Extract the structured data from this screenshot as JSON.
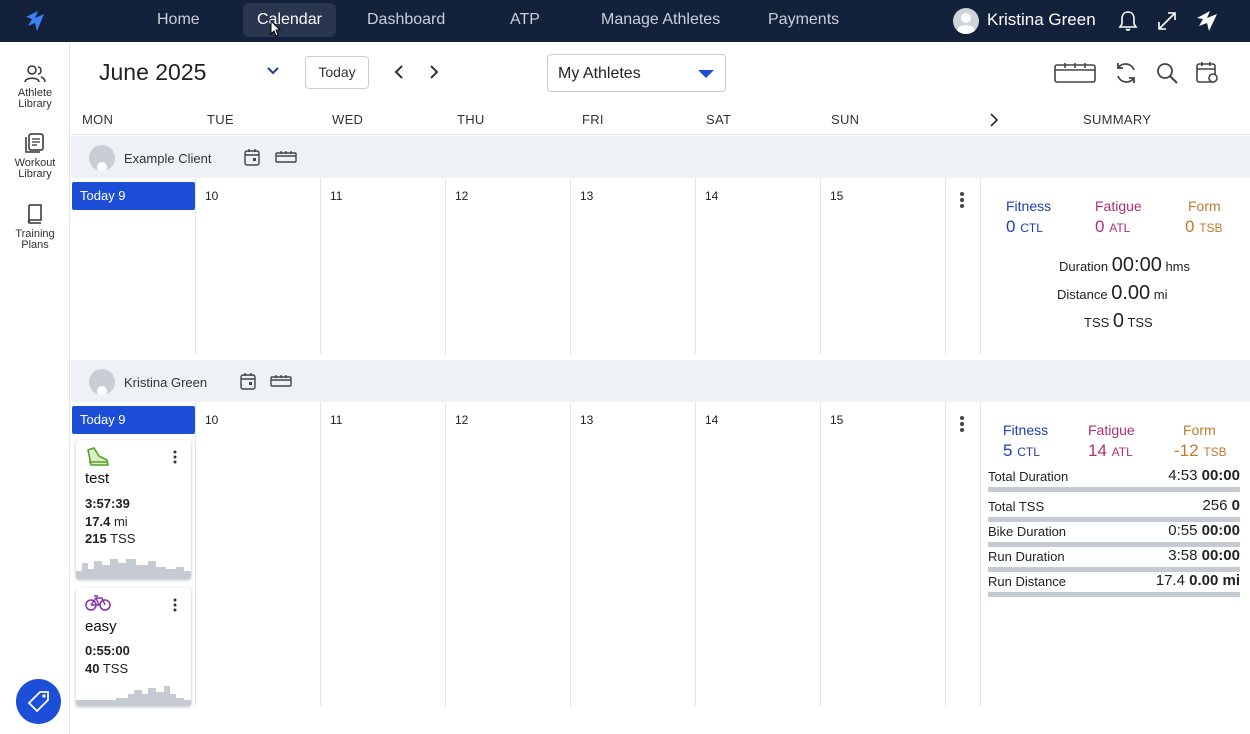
{
  "nav": {
    "items": [
      "Home",
      "Calendar",
      "Dashboard",
      "ATP",
      "Manage Athletes",
      "Payments"
    ],
    "active": "Calendar",
    "user_name": "Kristina Green"
  },
  "rail": {
    "athlete_library": [
      "Athlete",
      "Library"
    ],
    "workout_library": [
      "Workout",
      "Library"
    ],
    "training_plans": [
      "Training",
      "Plans"
    ]
  },
  "toolbar": {
    "month": "June 2025",
    "today": "Today",
    "athletes_select": "My Athletes"
  },
  "days": [
    "MON",
    "TUE",
    "WED",
    "THU",
    "FRI",
    "SAT",
    "SUN"
  ],
  "summary_header": "SUMMARY",
  "athletes": [
    {
      "name": "Example Client",
      "today_label": "Today 9",
      "dates": [
        "10",
        "11",
        "12",
        "13",
        "14",
        "15"
      ],
      "fitness": {
        "label": "Fitness",
        "value": "0",
        "unit": "CTL"
      },
      "fatigue": {
        "label": "Fatigue",
        "value": "0",
        "unit": "ATL"
      },
      "form": {
        "label": "Form",
        "value": "0",
        "unit": "TSB"
      },
      "duration": {
        "label": "Duration",
        "value": "00:00",
        "unit": "hms"
      },
      "distance": {
        "label": "Distance",
        "value": "0.00",
        "unit": "mi"
      },
      "tss": {
        "label": "TSS",
        "value": "0",
        "unit": "TSS"
      }
    },
    {
      "name": "Kristina Green",
      "today_label": "Today 9",
      "dates": [
        "10",
        "11",
        "12",
        "13",
        "14",
        "15"
      ],
      "fitness": {
        "label": "Fitness",
        "value": "5",
        "unit": "CTL"
      },
      "fatigue": {
        "label": "Fatigue",
        "value": "14",
        "unit": "ATL"
      },
      "form": {
        "label": "Form",
        "value": "-12",
        "unit": "TSB"
      },
      "rows": [
        {
          "label": "Total Duration",
          "value": "4:53",
          "planned": "00:00"
        },
        {
          "label": "Total TSS",
          "value": "256",
          "planned": "0"
        },
        {
          "label": "Bike Duration",
          "value": "0:55",
          "planned": "00:00"
        },
        {
          "label": "Run Duration",
          "value": "3:58",
          "planned": "00:00"
        },
        {
          "label": "Run Distance",
          "value": "17.4",
          "planned": "0.00 mi"
        }
      ],
      "workouts": [
        {
          "title": "test",
          "sport": "run",
          "duration": "3:57:39",
          "distance": "17.4",
          "distance_unit": "mi",
          "tss": "215",
          "tss_unit": "TSS"
        },
        {
          "title": "easy",
          "sport": "bike",
          "duration": "0:55:00",
          "tss": "40",
          "tss_unit": "TSS"
        }
      ]
    }
  ]
}
